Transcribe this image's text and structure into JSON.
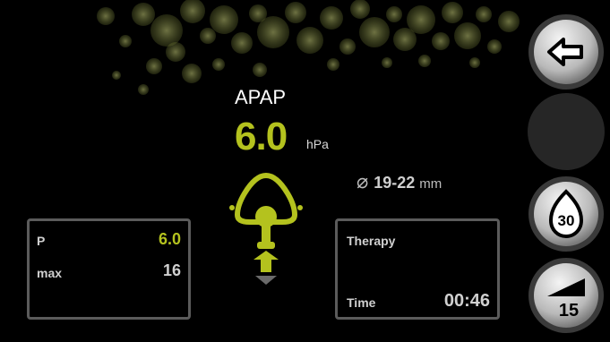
{
  "mode": {
    "title": "APAP"
  },
  "pressure": {
    "value": "6.0",
    "unit": "hPa"
  },
  "mask": {
    "icon": "diameter-icon",
    "size": "19-22",
    "unit": "mm"
  },
  "left_panel": {
    "p_label": "P",
    "p_value": "6.0",
    "max_label": "max",
    "max_value": "16"
  },
  "right_panel": {
    "therapy_label": "Therapy",
    "time_label": "Time",
    "time_value": "00:46"
  },
  "side_buttons": {
    "back_icon": "arrow-left-icon",
    "ramp_time_value": "30",
    "ramp_start_value": "15"
  },
  "colors": {
    "accent": "#b4c21e",
    "panel_border": "#5b5b5b",
    "background": "#000000"
  }
}
